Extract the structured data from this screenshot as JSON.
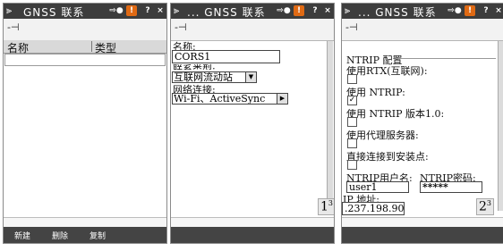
{
  "panel1": {
    "title": "GNSS 联系",
    "table": {
      "columns": [
        "名称",
        "类型"
      ]
    },
    "softkeys": [
      "新建",
      "删除",
      "复制"
    ]
  },
  "panel2": {
    "title": "... GNSS 联系",
    "name_label": "名称:",
    "name_value": "CORS1",
    "conn_type_label": "联系类型:",
    "conn_type_value": "互联网流动站",
    "network_label": "网络连接:",
    "network_value": "Wi-Fi、ActiveSync",
    "page": "1",
    "page_total": "3"
  },
  "panel3": {
    "title": "... GNSS 联系",
    "section_title": "NTRIP 配置",
    "options": [
      {
        "label": "使用RTX(互联网):",
        "checked": false
      },
      {
        "label": "使用 NTRIP:",
        "checked": true
      },
      {
        "label": "使用 NTRIP 版本1.0:",
        "checked": false
      },
      {
        "label": "使用代理服务器:",
        "checked": false
      },
      {
        "label": "直接连接到安装点:",
        "checked": false
      }
    ],
    "user_label": "NTRIP用户名:",
    "user_value": "user1",
    "pass_label": "NTRIP密码:",
    "pass_value": "*****",
    "ip_label": "IP 地址:",
    "ip_value": ".237.198.90",
    "page": "2",
    "page_total": "3"
  },
  "titlebar_buttons": {
    "warn": "!",
    "help": "?",
    "close": "×"
  },
  "toolbar_pin": "-⊣"
}
